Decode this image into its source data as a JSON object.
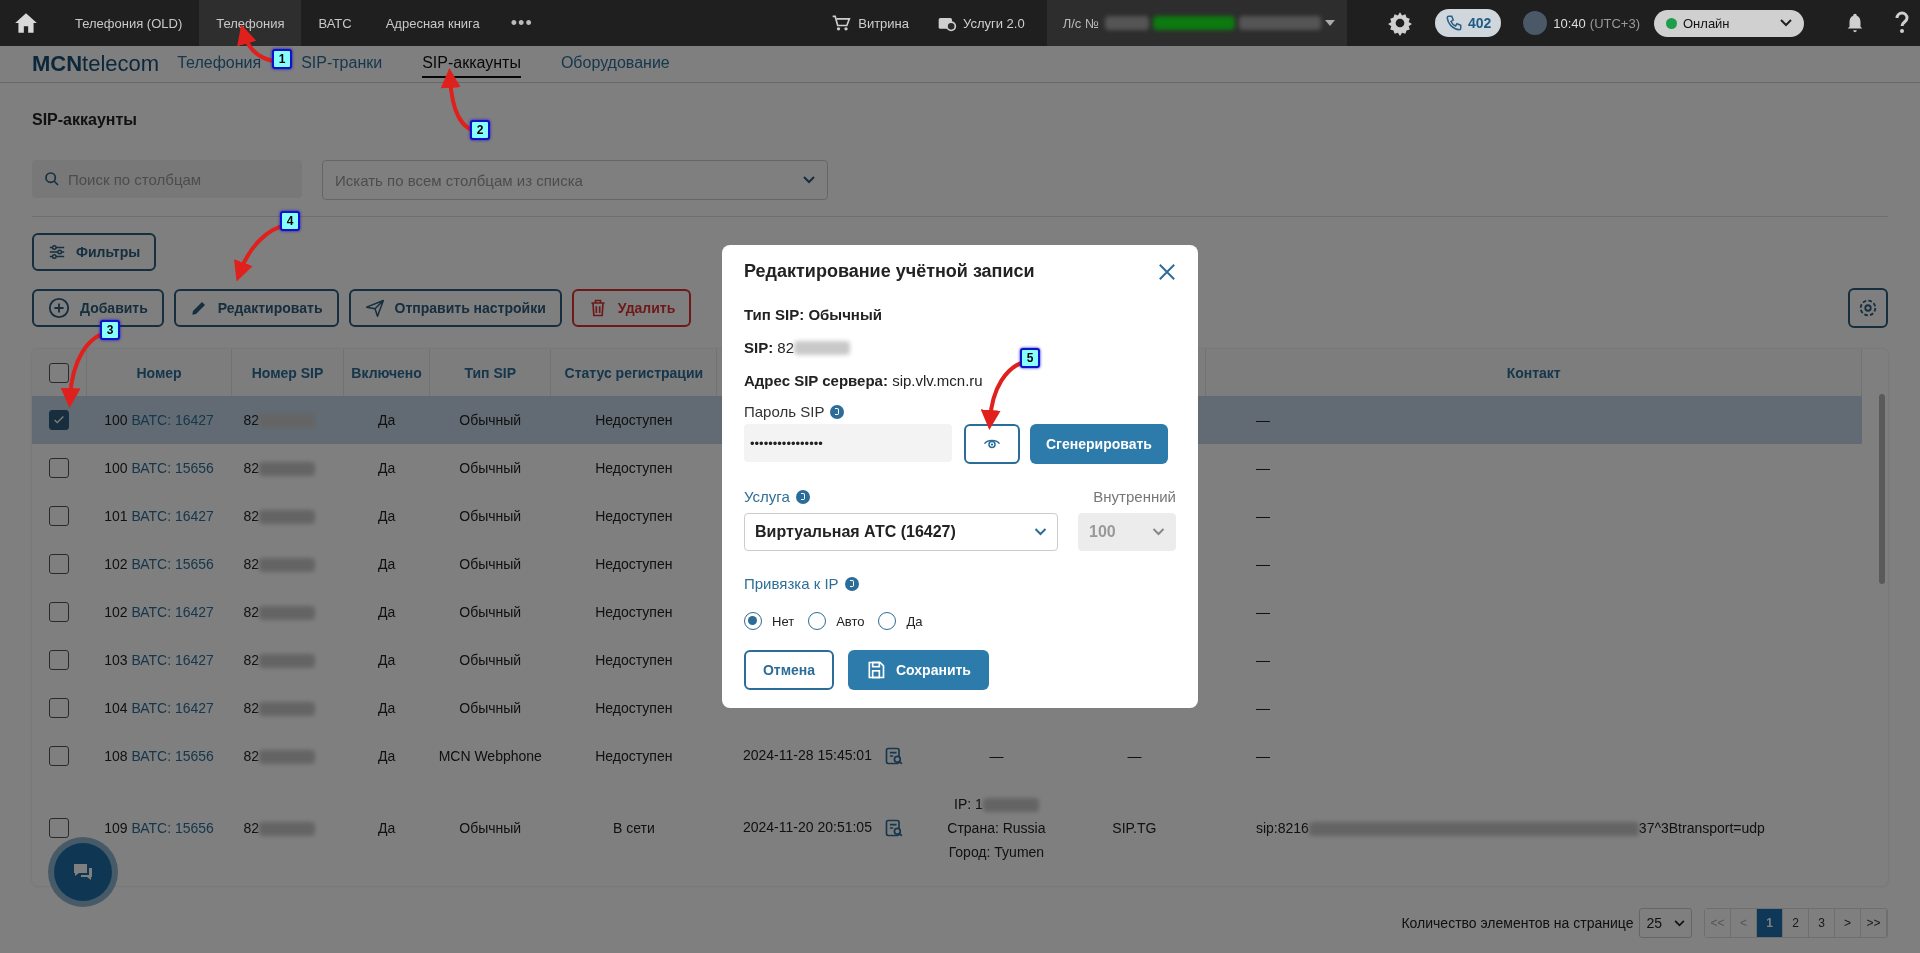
{
  "topbar": {
    "tabs": [
      {
        "label": "Телефония (OLD)",
        "selected": false
      },
      {
        "label": "Телефония",
        "selected": true
      },
      {
        "label": "ВАТС",
        "selected": false
      },
      {
        "label": "Адресная книга",
        "selected": false
      }
    ],
    "more": "•••",
    "shop": "Витрина",
    "services": "Услуги 2.0",
    "account": "Л/с №",
    "calls": "402",
    "time": "10:40",
    "timezone": "(UTC+3)",
    "status": {
      "label": "Онлайн",
      "color": "#1e9e4a"
    }
  },
  "subnav": {
    "logo": "**MCN**telecom",
    "links": [
      {
        "label": "Телефония",
        "selected": false
      },
      {
        "label": "SIP-транки",
        "selected": false
      },
      {
        "label": "SIP-аккаунты",
        "selected": true
      },
      {
        "label": "Оборудование",
        "selected": false
      }
    ]
  },
  "page_title": "SIP-аккаунты",
  "search": {
    "placeholder": "Поиск по столбцам"
  },
  "column_select": {
    "placeholder": "Искать по всем столбцам из списка"
  },
  "filters_button": "Фильтры",
  "actions": [
    {
      "label": "Добавить",
      "kind": "add"
    },
    {
      "label": "Редактировать",
      "kind": "edit"
    },
    {
      "label": "Отправить настройки",
      "kind": "send"
    },
    {
      "label": "Удалить",
      "kind": "delete"
    }
  ],
  "table": {
    "select_all": false,
    "columns": [
      "Номер",
      "Номер SIP",
      "Включено",
      "Тип SIP",
      "Статус регистрации",
      "Контакт"
    ],
    "rows": [
      {
        "selected": true,
        "number": "100",
        "pbx": "ВАТС: 16427",
        "sip": "82",
        "enabled": "Да",
        "type": "Обычный",
        "status": "Недоступен",
        "contact": "—"
      },
      {
        "selected": false,
        "number": "100",
        "pbx": "ВАТС: 15656",
        "sip": "82",
        "enabled": "Да",
        "type": "Обычный",
        "status": "Недоступен",
        "contact": "—"
      },
      {
        "selected": false,
        "number": "101",
        "pbx": "ВАТС: 16427",
        "sip": "82",
        "enabled": "Да",
        "type": "Обычный",
        "status": "Недоступен",
        "contact": "—"
      },
      {
        "selected": false,
        "number": "102",
        "pbx": "ВАТС: 15656",
        "sip": "82",
        "enabled": "Да",
        "type": "Обычный",
        "status": "Недоступен",
        "contact": "—"
      },
      {
        "selected": false,
        "number": "102",
        "pbx": "ВАТС: 16427",
        "sip": "82",
        "enabled": "Да",
        "type": "Обычный",
        "status": "Недоступен",
        "contact": "—"
      },
      {
        "selected": false,
        "number": "103",
        "pbx": "ВАТС: 16427",
        "sip": "82",
        "enabled": "Да",
        "type": "Обычный",
        "status": "Недоступен",
        "contact": "—"
      },
      {
        "selected": false,
        "number": "104",
        "pbx": "ВАТС: 16427",
        "sip": "82",
        "enabled": "Да",
        "type": "Обычный",
        "status": "Недоступен",
        "contact": "—"
      },
      {
        "selected": false,
        "number": "108",
        "pbx": "ВАТС: 15656",
        "sip": "82",
        "enabled": "Да",
        "type": "MCN Webphone",
        "status": "Недоступен",
        "date": "2024-11-28 15:45:01",
        "column_7": [
          "—"
        ],
        "column_8": "—",
        "contact": "—"
      },
      {
        "selected": false,
        "number": "109",
        "pbx": "ВАТС: 15656",
        "sip": "82",
        "enabled": "Да",
        "type": "Обычный",
        "status": "В сети",
        "date": "2024-11-20 20:51:05",
        "column_7": [
          "IP: 1",
          "Страна: Russia",
          "Город: Tyumen"
        ],
        "column_8": "SIP.TG",
        "contact": "sip:8216",
        "contact_end": "37^3Btransport=udp"
      }
    ]
  },
  "pagination": {
    "label": "Количество элементов на странице",
    "page_size": "25",
    "pages": [
      {
        "label": "<<",
        "selected": false,
        "disabled": true
      },
      {
        "label": "<",
        "selected": false,
        "disabled": true
      },
      {
        "label": "1",
        "selected": true,
        "disabled": false
      },
      {
        "label": "2",
        "selected": false,
        "disabled": false
      },
      {
        "label": "3",
        "selected": false,
        "disabled": false
      },
      {
        "label": ">",
        "selected": false,
        "disabled": false
      },
      {
        "label": ">>",
        "selected": false,
        "disabled": false
      }
    ]
  },
  "modal": {
    "title": "Редактирование учётной записи",
    "sip_type": "**Тип SIP:** **Обычный**",
    "sip": "**SIP:** 82",
    "server": "**Адрес SIP сервера:** sip.vlv.mcn.ru",
    "password_label": "Пароль SIP",
    "password": "••••••••••••••••",
    "generate": "Сгенерировать",
    "service_label": "Услуга",
    "service": "Виртуальная АТС (16427)",
    "internal_label": "Внутренний",
    "internal": "100",
    "internal_disabled": true,
    "ip_label": "Привязка к IP",
    "ip_options": [
      {
        "label": "Нет",
        "selected": true
      },
      {
        "label": "Авто",
        "selected": false
      },
      {
        "label": "Да",
        "selected": false
      }
    ],
    "cancel": "Отмена",
    "save": "Сохранить"
  },
  "callouts": [
    {
      "label": "1"
    },
    {
      "label": "2"
    },
    {
      "label": "3"
    },
    {
      "label": "4"
    },
    {
      "label": "5"
    }
  ]
}
